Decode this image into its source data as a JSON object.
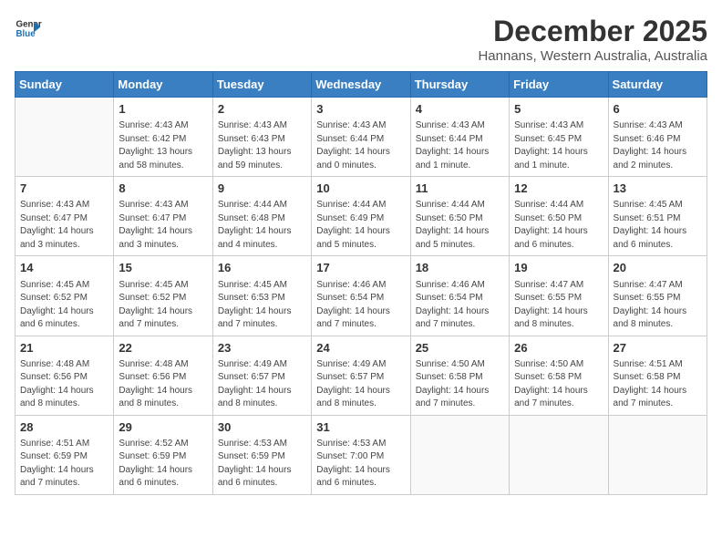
{
  "header": {
    "logo_line1": "General",
    "logo_line2": "Blue",
    "title": "December 2025",
    "subtitle": "Hannans, Western Australia, Australia"
  },
  "calendar": {
    "days_of_week": [
      "Sunday",
      "Monday",
      "Tuesday",
      "Wednesday",
      "Thursday",
      "Friday",
      "Saturday"
    ],
    "weeks": [
      [
        {
          "day": "",
          "info": ""
        },
        {
          "day": "1",
          "info": "Sunrise: 4:43 AM\nSunset: 6:42 PM\nDaylight: 13 hours\nand 58 minutes."
        },
        {
          "day": "2",
          "info": "Sunrise: 4:43 AM\nSunset: 6:43 PM\nDaylight: 13 hours\nand 59 minutes."
        },
        {
          "day": "3",
          "info": "Sunrise: 4:43 AM\nSunset: 6:44 PM\nDaylight: 14 hours\nand 0 minutes."
        },
        {
          "day": "4",
          "info": "Sunrise: 4:43 AM\nSunset: 6:44 PM\nDaylight: 14 hours\nand 1 minute."
        },
        {
          "day": "5",
          "info": "Sunrise: 4:43 AM\nSunset: 6:45 PM\nDaylight: 14 hours\nand 1 minute."
        },
        {
          "day": "6",
          "info": "Sunrise: 4:43 AM\nSunset: 6:46 PM\nDaylight: 14 hours\nand 2 minutes."
        }
      ],
      [
        {
          "day": "7",
          "info": "Sunrise: 4:43 AM\nSunset: 6:47 PM\nDaylight: 14 hours\nand 3 minutes."
        },
        {
          "day": "8",
          "info": "Sunrise: 4:43 AM\nSunset: 6:47 PM\nDaylight: 14 hours\nand 3 minutes."
        },
        {
          "day": "9",
          "info": "Sunrise: 4:44 AM\nSunset: 6:48 PM\nDaylight: 14 hours\nand 4 minutes."
        },
        {
          "day": "10",
          "info": "Sunrise: 4:44 AM\nSunset: 6:49 PM\nDaylight: 14 hours\nand 5 minutes."
        },
        {
          "day": "11",
          "info": "Sunrise: 4:44 AM\nSunset: 6:50 PM\nDaylight: 14 hours\nand 5 minutes."
        },
        {
          "day": "12",
          "info": "Sunrise: 4:44 AM\nSunset: 6:50 PM\nDaylight: 14 hours\nand 6 minutes."
        },
        {
          "day": "13",
          "info": "Sunrise: 4:45 AM\nSunset: 6:51 PM\nDaylight: 14 hours\nand 6 minutes."
        }
      ],
      [
        {
          "day": "14",
          "info": "Sunrise: 4:45 AM\nSunset: 6:52 PM\nDaylight: 14 hours\nand 6 minutes."
        },
        {
          "day": "15",
          "info": "Sunrise: 4:45 AM\nSunset: 6:52 PM\nDaylight: 14 hours\nand 7 minutes."
        },
        {
          "day": "16",
          "info": "Sunrise: 4:45 AM\nSunset: 6:53 PM\nDaylight: 14 hours\nand 7 minutes."
        },
        {
          "day": "17",
          "info": "Sunrise: 4:46 AM\nSunset: 6:54 PM\nDaylight: 14 hours\nand 7 minutes."
        },
        {
          "day": "18",
          "info": "Sunrise: 4:46 AM\nSunset: 6:54 PM\nDaylight: 14 hours\nand 7 minutes."
        },
        {
          "day": "19",
          "info": "Sunrise: 4:47 AM\nSunset: 6:55 PM\nDaylight: 14 hours\nand 8 minutes."
        },
        {
          "day": "20",
          "info": "Sunrise: 4:47 AM\nSunset: 6:55 PM\nDaylight: 14 hours\nand 8 minutes."
        }
      ],
      [
        {
          "day": "21",
          "info": "Sunrise: 4:48 AM\nSunset: 6:56 PM\nDaylight: 14 hours\nand 8 minutes."
        },
        {
          "day": "22",
          "info": "Sunrise: 4:48 AM\nSunset: 6:56 PM\nDaylight: 14 hours\nand 8 minutes."
        },
        {
          "day": "23",
          "info": "Sunrise: 4:49 AM\nSunset: 6:57 PM\nDaylight: 14 hours\nand 8 minutes."
        },
        {
          "day": "24",
          "info": "Sunrise: 4:49 AM\nSunset: 6:57 PM\nDaylight: 14 hours\nand 8 minutes."
        },
        {
          "day": "25",
          "info": "Sunrise: 4:50 AM\nSunset: 6:58 PM\nDaylight: 14 hours\nand 7 minutes."
        },
        {
          "day": "26",
          "info": "Sunrise: 4:50 AM\nSunset: 6:58 PM\nDaylight: 14 hours\nand 7 minutes."
        },
        {
          "day": "27",
          "info": "Sunrise: 4:51 AM\nSunset: 6:58 PM\nDaylight: 14 hours\nand 7 minutes."
        }
      ],
      [
        {
          "day": "28",
          "info": "Sunrise: 4:51 AM\nSunset: 6:59 PM\nDaylight: 14 hours\nand 7 minutes."
        },
        {
          "day": "29",
          "info": "Sunrise: 4:52 AM\nSunset: 6:59 PM\nDaylight: 14 hours\nand 6 minutes."
        },
        {
          "day": "30",
          "info": "Sunrise: 4:53 AM\nSunset: 6:59 PM\nDaylight: 14 hours\nand 6 minutes."
        },
        {
          "day": "31",
          "info": "Sunrise: 4:53 AM\nSunset: 7:00 PM\nDaylight: 14 hours\nand 6 minutes."
        },
        {
          "day": "",
          "info": ""
        },
        {
          "day": "",
          "info": ""
        },
        {
          "day": "",
          "info": ""
        }
      ]
    ]
  }
}
